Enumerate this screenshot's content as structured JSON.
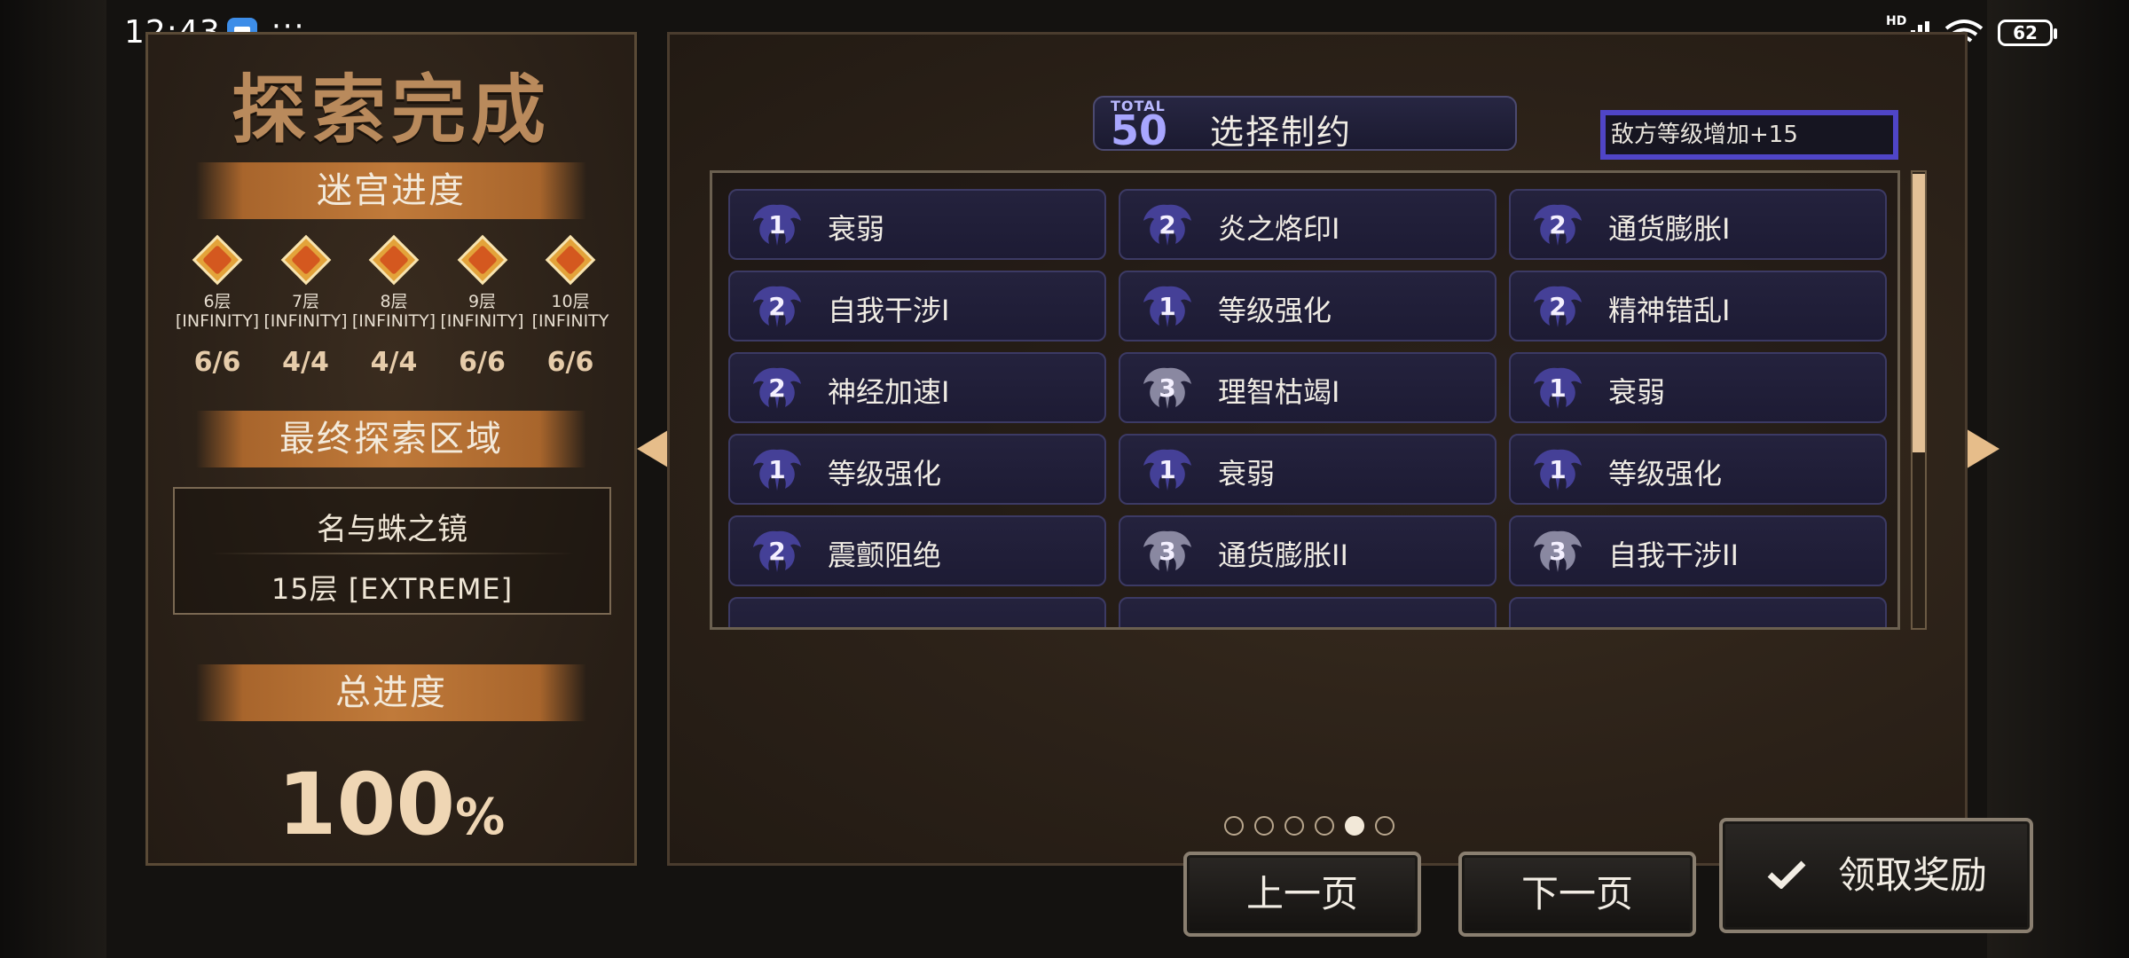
{
  "status_bar": {
    "time": "12:43",
    "more": "···",
    "network": "HD",
    "battery": "62"
  },
  "left": {
    "title": "探索完成",
    "maze_progress_label": "迷宫进度",
    "floors": [
      {
        "name": "6层",
        "diff": "[INFINITY]",
        "count": "6/6"
      },
      {
        "name": "7层",
        "diff": "[INFINITY]",
        "count": "4/4"
      },
      {
        "name": "8层",
        "diff": "[INFINITY]",
        "count": "4/4"
      },
      {
        "name": "9层",
        "diff": "[INFINITY]",
        "count": "6/6"
      },
      {
        "name": "10层",
        "diff": "[INFINITY",
        "count": "6/6"
      }
    ],
    "final_zone_label": "最终探索区域",
    "zone_name": "名与蛛之镜",
    "zone_floor": "15层 [EXTREME]",
    "total_progress_label": "总进度",
    "total_progress": "100",
    "total_progress_unit": "%"
  },
  "right": {
    "total_label": "TOTAL",
    "total_value": "50",
    "title": "选择制约",
    "enemy_level": "敌方等级增加+15",
    "cards": [
      {
        "level": "1",
        "label": "衰弱"
      },
      {
        "level": "2",
        "label": "炎之烙印I"
      },
      {
        "level": "2",
        "label": "通货膨胀I"
      },
      {
        "level": "2",
        "label": "自我干涉I"
      },
      {
        "level": "1",
        "label": "等级强化"
      },
      {
        "level": "2",
        "label": "精神错乱I"
      },
      {
        "level": "2",
        "label": "神经加速I"
      },
      {
        "level": "3",
        "label": "理智枯竭I"
      },
      {
        "level": "1",
        "label": "衰弱"
      },
      {
        "level": "1",
        "label": "等级强化"
      },
      {
        "level": "1",
        "label": "衰弱"
      },
      {
        "level": "1",
        "label": "等级强化"
      },
      {
        "level": "2",
        "label": "震颤阻绝"
      },
      {
        "level": "3",
        "label": "通货膨胀II"
      },
      {
        "level": "3",
        "label": "自我干涉II"
      }
    ],
    "pages": {
      "count": 6,
      "active_index": 4
    },
    "buttons": {
      "prev": "上一页",
      "next": "下一页",
      "claim": "领取奖励"
    }
  },
  "colors": {
    "accent": "#4f45c7",
    "card_bg": "#1d1b34",
    "banner": "#c07a3a"
  }
}
